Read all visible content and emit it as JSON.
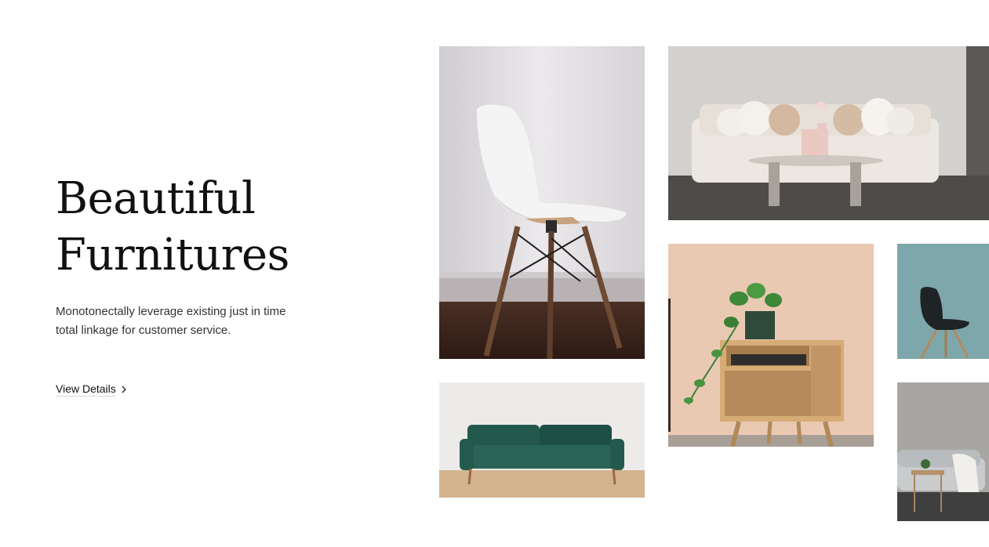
{
  "hero": {
    "title_line1": "Beautiful",
    "title_line2": "Furnitures",
    "description": "Monotonectally leverage existing just in time total linkage for customer service.",
    "cta_label": "View Details"
  },
  "gallery": [
    {
      "name": "white-chair-photo"
    },
    {
      "name": "cream-sofa-photo"
    },
    {
      "name": "wooden-side-table-photo"
    },
    {
      "name": "black-chair-photo"
    },
    {
      "name": "green-sofa-photo"
    },
    {
      "name": "gray-living-room-photo"
    }
  ],
  "icons": {
    "cta_arrow": "chevron-right-icon"
  }
}
